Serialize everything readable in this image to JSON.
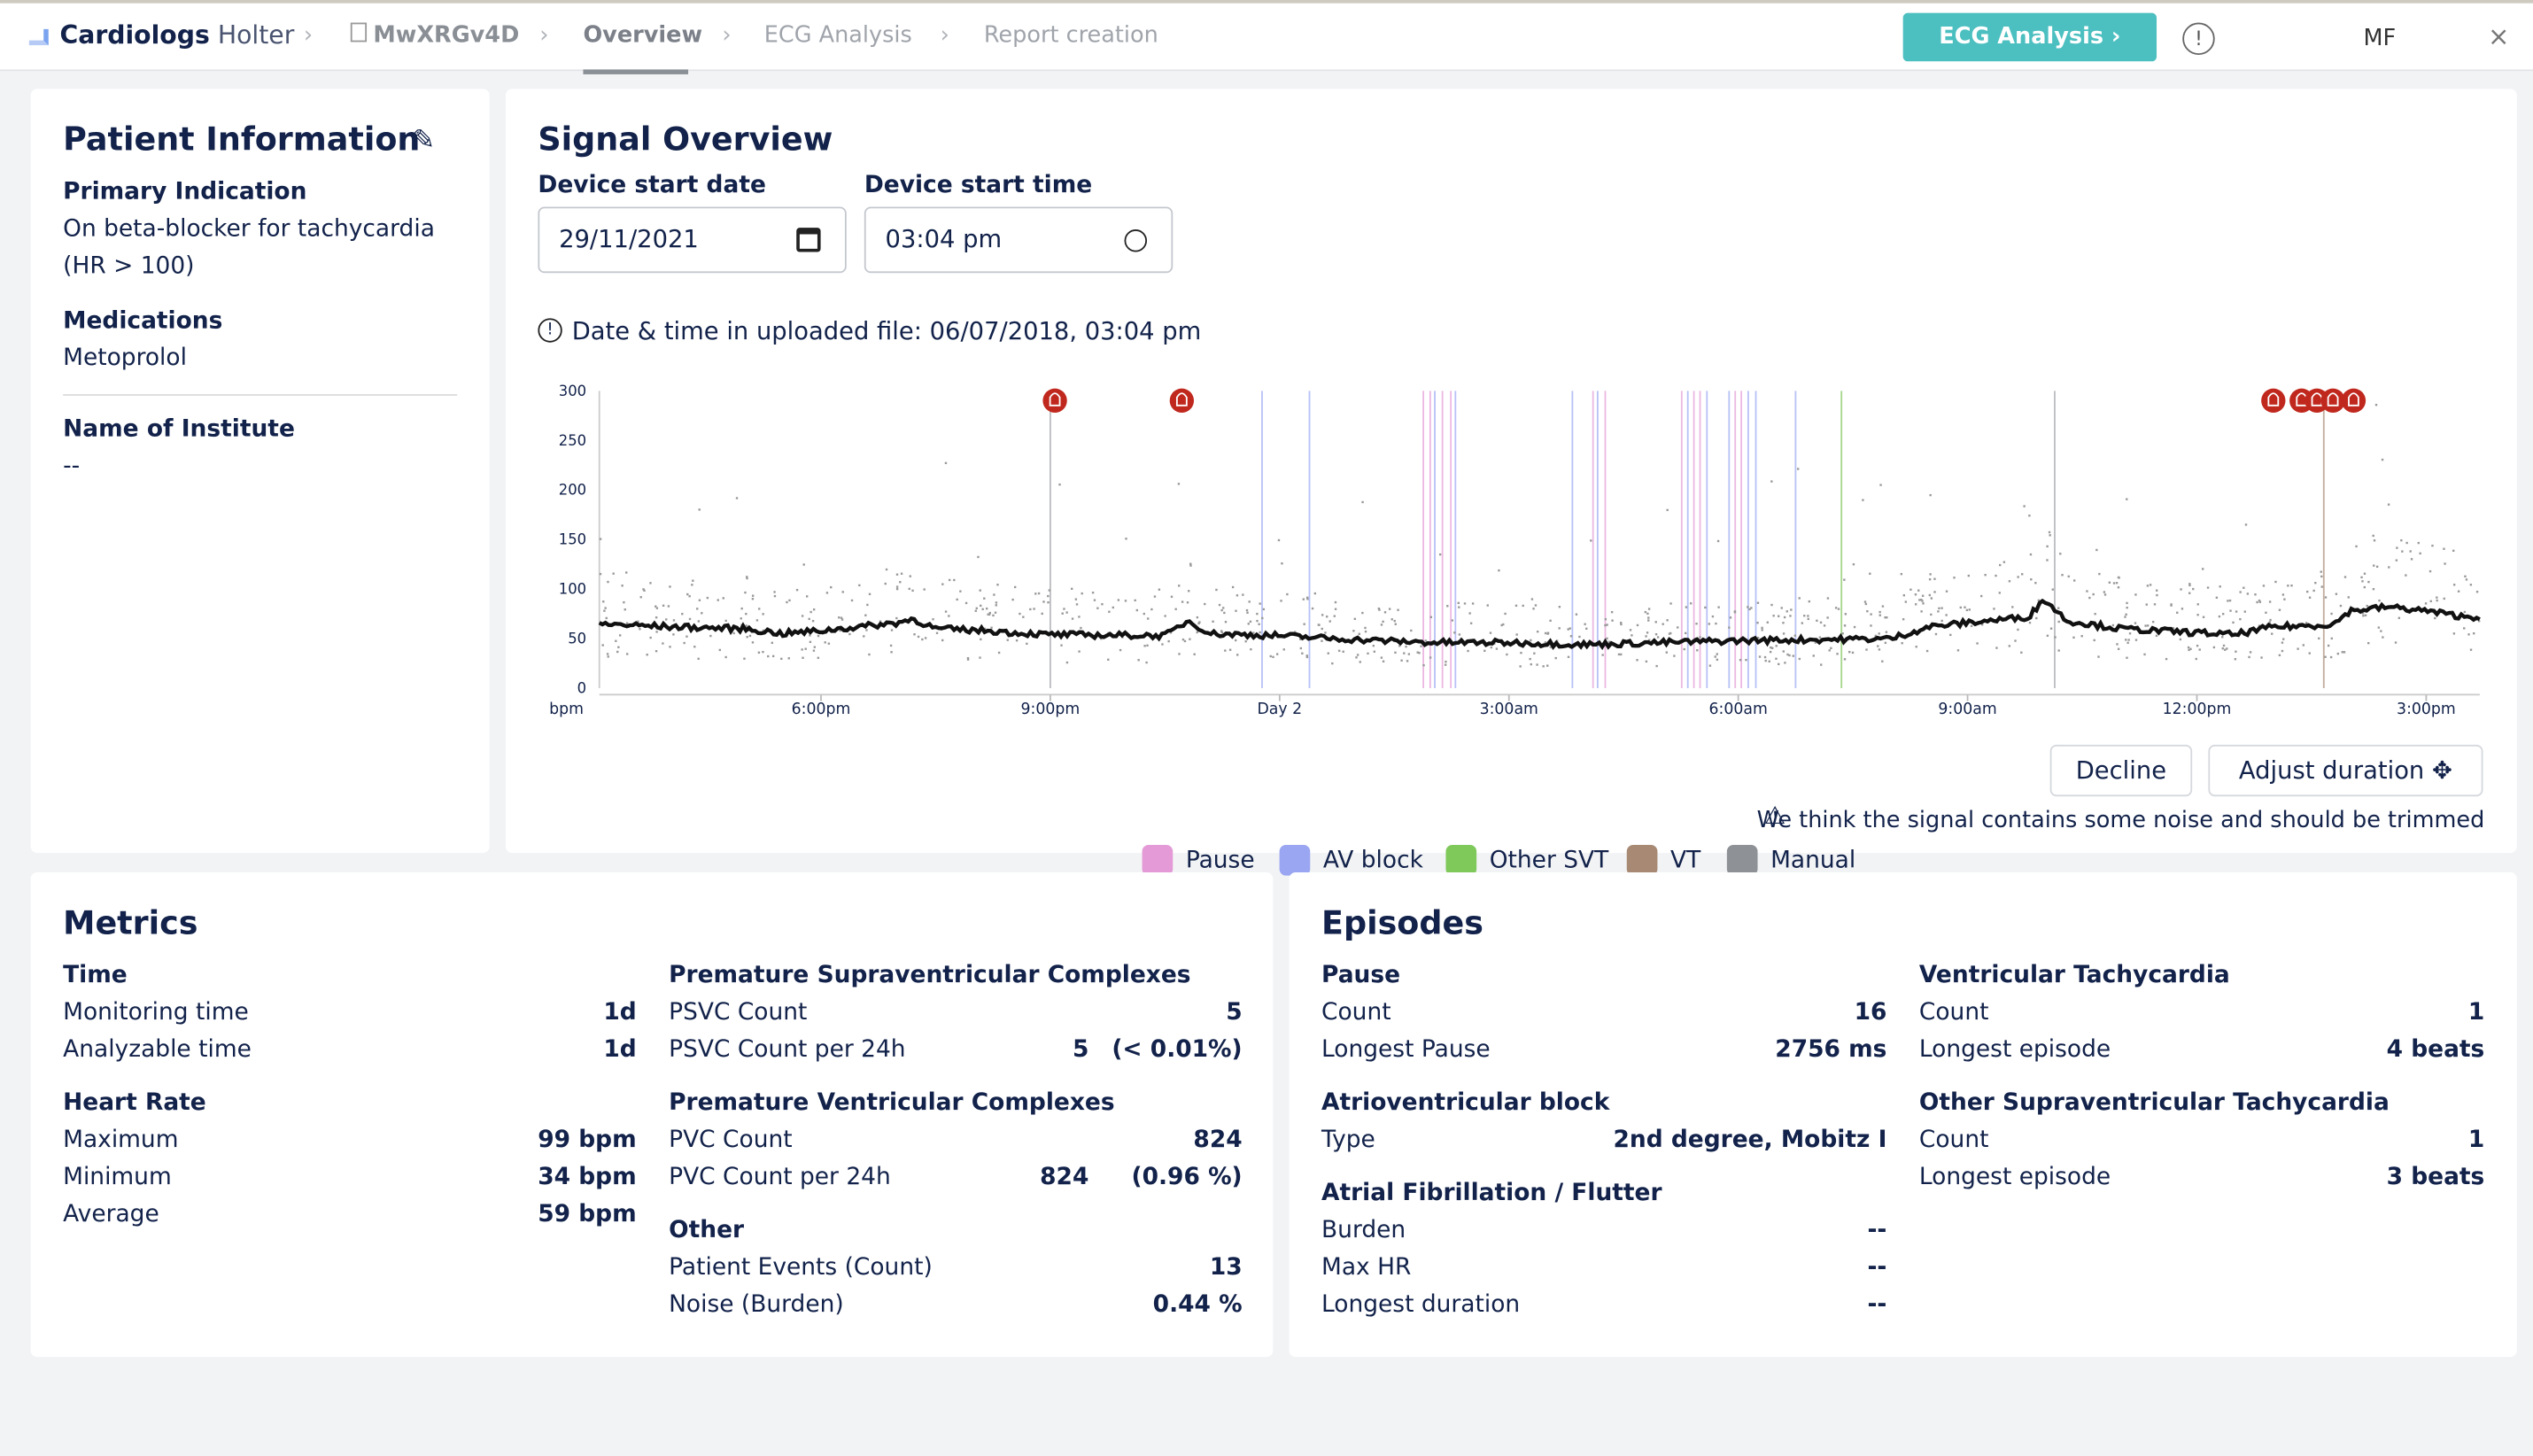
{
  "header": {
    "brand_bold": "Cardiologs",
    "brand_light": "Holter",
    "record_id": "MwXRGv4D",
    "tabs": [
      {
        "label": "Overview",
        "active": true
      },
      {
        "label": "ECG Analysis"
      },
      {
        "label": "Report creation"
      }
    ],
    "cta": "ECG Analysis",
    "user_initials": "MF",
    "accent": "#4cbfc0"
  },
  "patient": {
    "title": "Patient Information",
    "indication_label": "Primary Indication",
    "indication": "On beta-blocker for tachycardia",
    "indication2": "(HR > 100)",
    "medications_label": "Medications",
    "medications": "Metoprolol",
    "institute_label": "Name of Institute",
    "institute": "--"
  },
  "signal": {
    "title": "Signal Overview",
    "date_label": "Device start date",
    "date_value": "29/11/2021",
    "time_label": "Device start time",
    "time_value": "03:04 pm",
    "file_info": "Date & time in uploaded file: 06/07/2018, 03:04 pm",
    "decline": "Decline",
    "adjust": "Adjust duration",
    "warning": "We think the signal contains some noise and should be trimmed"
  },
  "chart_data": {
    "type": "line",
    "ylabel": "bpm",
    "ylim": [
      0,
      300
    ],
    "yticks": [
      "0",
      "50",
      "100",
      "150",
      "200",
      "250",
      "300"
    ],
    "xticks": [
      {
        "label": "6:00pm",
        "h": 3
      },
      {
        "label": "9:00pm",
        "h": 6
      },
      {
        "label": "Day 2",
        "h": 9
      },
      {
        "label": "3:00am",
        "h": 12
      },
      {
        "label": "6:00am",
        "h": 15
      },
      {
        "label": "9:00am",
        "h": 18
      },
      {
        "label": "12:00pm",
        "h": 21
      },
      {
        "label": "3:00pm",
        "h": 24
      }
    ],
    "xrange_hours_from_3pm": [
      0.1,
      24.7
    ],
    "legend": [
      {
        "name": "Pause",
        "color": "#e39ad6"
      },
      {
        "name": "AV block",
        "color": "#9aa6f2"
      },
      {
        "name": "Other SVT",
        "color": "#7fc85a"
      },
      {
        "name": "VT",
        "color": "#a88a74"
      },
      {
        "name": "Manual",
        "color": "#8e9196"
      }
    ],
    "heart_rate": {
      "x_hours": [
        0.1,
        1,
        2,
        2.5,
        3,
        4,
        4.2,
        4.5,
        5.2,
        5.5,
        6,
        7.5,
        7.8,
        8.1,
        9,
        10,
        11,
        12,
        13,
        14,
        15,
        16,
        17,
        17.5,
        18,
        18.8,
        19,
        19.3,
        20,
        21,
        21.5,
        22,
        22.5,
        22.8,
        23,
        23.5,
        24,
        24.5
      ],
      "bpm": [
        65,
        62,
        60,
        55,
        58,
        66,
        70,
        60,
        58,
        56,
        54,
        53,
        68,
        55,
        53,
        49,
        46,
        46,
        44,
        46,
        48,
        49,
        50,
        62,
        66,
        72,
        90,
        68,
        60,
        56,
        54,
        62,
        63,
        65,
        78,
        82,
        78,
        72
      ]
    },
    "events": [
      {
        "type": "Manual",
        "h": 6.0
      },
      {
        "type": "AV block",
        "h": 8.77
      },
      {
        "type": "AV block",
        "h": 9.39
      },
      {
        "type": "Pause",
        "h": 10.88
      },
      {
        "type": "Pause",
        "h": 10.97
      },
      {
        "type": "AV block",
        "h": 11.03
      },
      {
        "type": "Pause",
        "h": 11.13
      },
      {
        "type": "Pause",
        "h": 11.24
      },
      {
        "type": "AV block",
        "h": 11.3
      },
      {
        "type": "AV block",
        "h": 12.83
      },
      {
        "type": "Pause",
        "h": 13.1
      },
      {
        "type": "AV block",
        "h": 13.16
      },
      {
        "type": "Pause",
        "h": 13.26
      },
      {
        "type": "Pause",
        "h": 14.26
      },
      {
        "type": "AV block",
        "h": 14.34
      },
      {
        "type": "Pause",
        "h": 14.42
      },
      {
        "type": "Pause",
        "h": 14.5
      },
      {
        "type": "AV block",
        "h": 14.59
      },
      {
        "type": "AV block",
        "h": 14.88
      },
      {
        "type": "Pause",
        "h": 14.96
      },
      {
        "type": "Pause",
        "h": 15.04
      },
      {
        "type": "AV block",
        "h": 15.13
      },
      {
        "type": "AV block",
        "h": 15.23
      },
      {
        "type": "AV block",
        "h": 15.75
      },
      {
        "type": "Other SVT",
        "h": 16.35
      },
      {
        "type": "Manual",
        "h": 19.14
      },
      {
        "type": "VT",
        "h": 22.66
      }
    ],
    "patient_events_h": [
      6.06,
      7.72,
      22.0,
      22.37,
      22.57,
      22.78,
      23.05
    ]
  },
  "metrics": {
    "title": "Metrics",
    "time": {
      "label": "Time",
      "rows": [
        [
          "Monitoring time",
          "1d"
        ],
        [
          "Analyzable time",
          "1d"
        ]
      ]
    },
    "hr": {
      "label": "Heart Rate",
      "rows": [
        [
          "Maximum",
          "99 bpm"
        ],
        [
          "Minimum",
          "34 bpm"
        ],
        [
          "Average",
          "59 bpm"
        ]
      ]
    },
    "psvc": {
      "label": "Premature Supraventricular Complexes",
      "rows": [
        [
          "PSVC Count",
          "5",
          ""
        ],
        [
          "PSVC Count per 24h",
          "5",
          "(< 0.01%)"
        ]
      ]
    },
    "pvc": {
      "label": "Premature Ventricular Complexes",
      "rows": [
        [
          "PVC Count",
          "824",
          ""
        ],
        [
          "PVC Count per 24h",
          "824",
          "(0.96 %)"
        ]
      ]
    },
    "other": {
      "label": "Other",
      "rows": [
        [
          "Patient Events (Count)",
          "13"
        ],
        [
          "Noise (Burden)",
          "0.44 %"
        ]
      ]
    }
  },
  "episodes": {
    "title": "Episodes",
    "pause": {
      "label": "Pause",
      "rows": [
        [
          "Count",
          "16"
        ],
        [
          "Longest Pause",
          "2756 ms"
        ]
      ]
    },
    "av": {
      "label": "Atrioventricular block",
      "rows": [
        [
          "Type",
          "2nd degree, Mobitz I"
        ]
      ]
    },
    "af": {
      "label": "Atrial Fibrillation / Flutter",
      "rows": [
        [
          "Burden",
          "--"
        ],
        [
          "Max HR",
          "--"
        ],
        [
          "Longest duration",
          "--"
        ]
      ]
    },
    "vt": {
      "label": "Ventricular Tachycardia",
      "rows": [
        [
          "Count",
          "1"
        ],
        [
          "Longest episode",
          "4 beats"
        ]
      ]
    },
    "svt": {
      "label": "Other Supraventricular Tachycardia",
      "rows": [
        [
          "Count",
          "1"
        ],
        [
          "Longest episode",
          "3 beats"
        ]
      ]
    }
  }
}
